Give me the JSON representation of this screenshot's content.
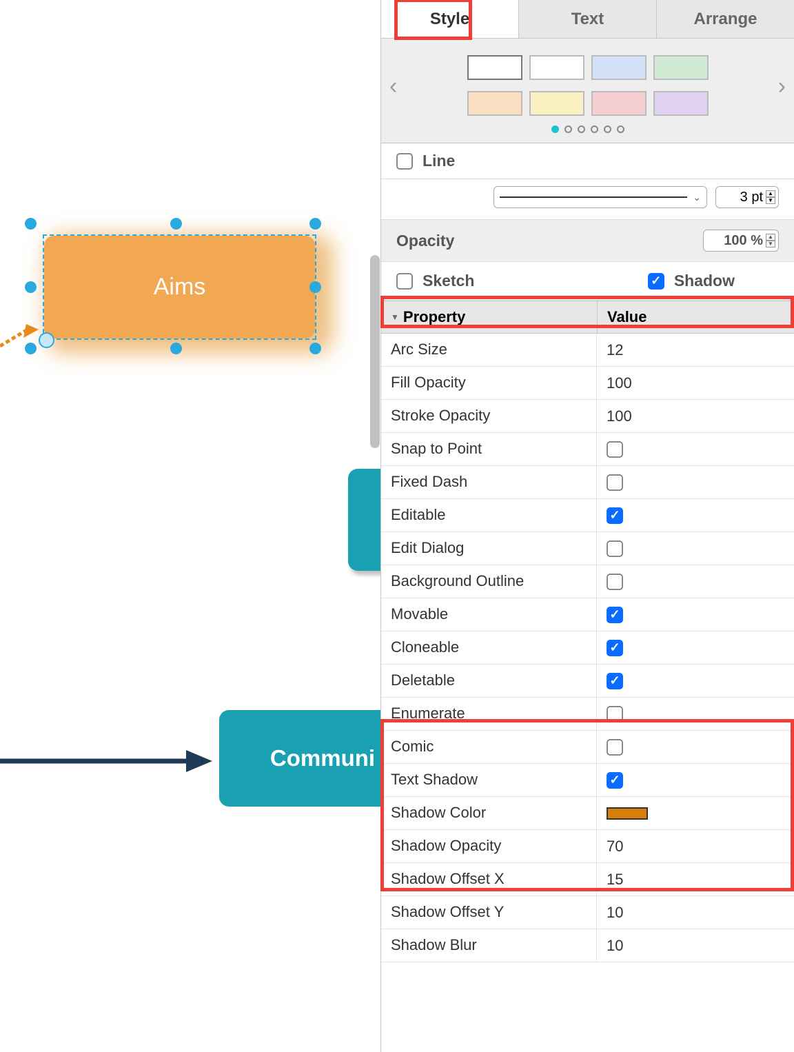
{
  "tabs": {
    "style": "Style",
    "text": "Text",
    "arrange": "Arrange"
  },
  "swatches": {
    "row1": [
      "#ffffff",
      "#ffffff",
      "#d3e2f8",
      "#d1ead3"
    ],
    "row2": [
      "#fadec1",
      "#fbf0c1",
      "#f6d0d0",
      "#e1d3ef"
    ]
  },
  "line": {
    "label": "Line",
    "pt": "3 pt"
  },
  "opacity": {
    "label": "Opacity",
    "value": "100 %"
  },
  "sketch": {
    "label": "Sketch"
  },
  "shadow": {
    "label": "Shadow"
  },
  "propHeader": {
    "prop": "Property",
    "val": "Value"
  },
  "props": [
    {
      "name": "Arc Size",
      "value": "12",
      "type": "text"
    },
    {
      "name": "Fill Opacity",
      "value": "100",
      "type": "text"
    },
    {
      "name": "Stroke Opacity",
      "value": "100",
      "type": "text"
    },
    {
      "name": "Snap to Point",
      "value": false,
      "type": "check"
    },
    {
      "name": "Fixed Dash",
      "value": false,
      "type": "check"
    },
    {
      "name": "Editable",
      "value": true,
      "type": "check"
    },
    {
      "name": "Edit Dialog",
      "value": false,
      "type": "check"
    },
    {
      "name": "Background Outline",
      "value": false,
      "type": "check"
    },
    {
      "name": "Movable",
      "value": true,
      "type": "check"
    },
    {
      "name": "Cloneable",
      "value": true,
      "type": "check"
    },
    {
      "name": "Deletable",
      "value": true,
      "type": "check"
    },
    {
      "name": "Enumerate",
      "value": false,
      "type": "check"
    },
    {
      "name": "Comic",
      "value": false,
      "type": "check"
    },
    {
      "name": "Text Shadow",
      "value": true,
      "type": "check"
    },
    {
      "name": "Shadow Color",
      "value": "#d87f0a",
      "type": "color"
    },
    {
      "name": "Shadow Opacity",
      "value": "70",
      "type": "text"
    },
    {
      "name": "Shadow Offset X",
      "value": "15",
      "type": "text"
    },
    {
      "name": "Shadow Offset Y",
      "value": "10",
      "type": "text"
    },
    {
      "name": "Shadow Blur",
      "value": "10",
      "type": "text"
    }
  ],
  "canvas": {
    "aims": "Aims",
    "comm": "Communi"
  }
}
